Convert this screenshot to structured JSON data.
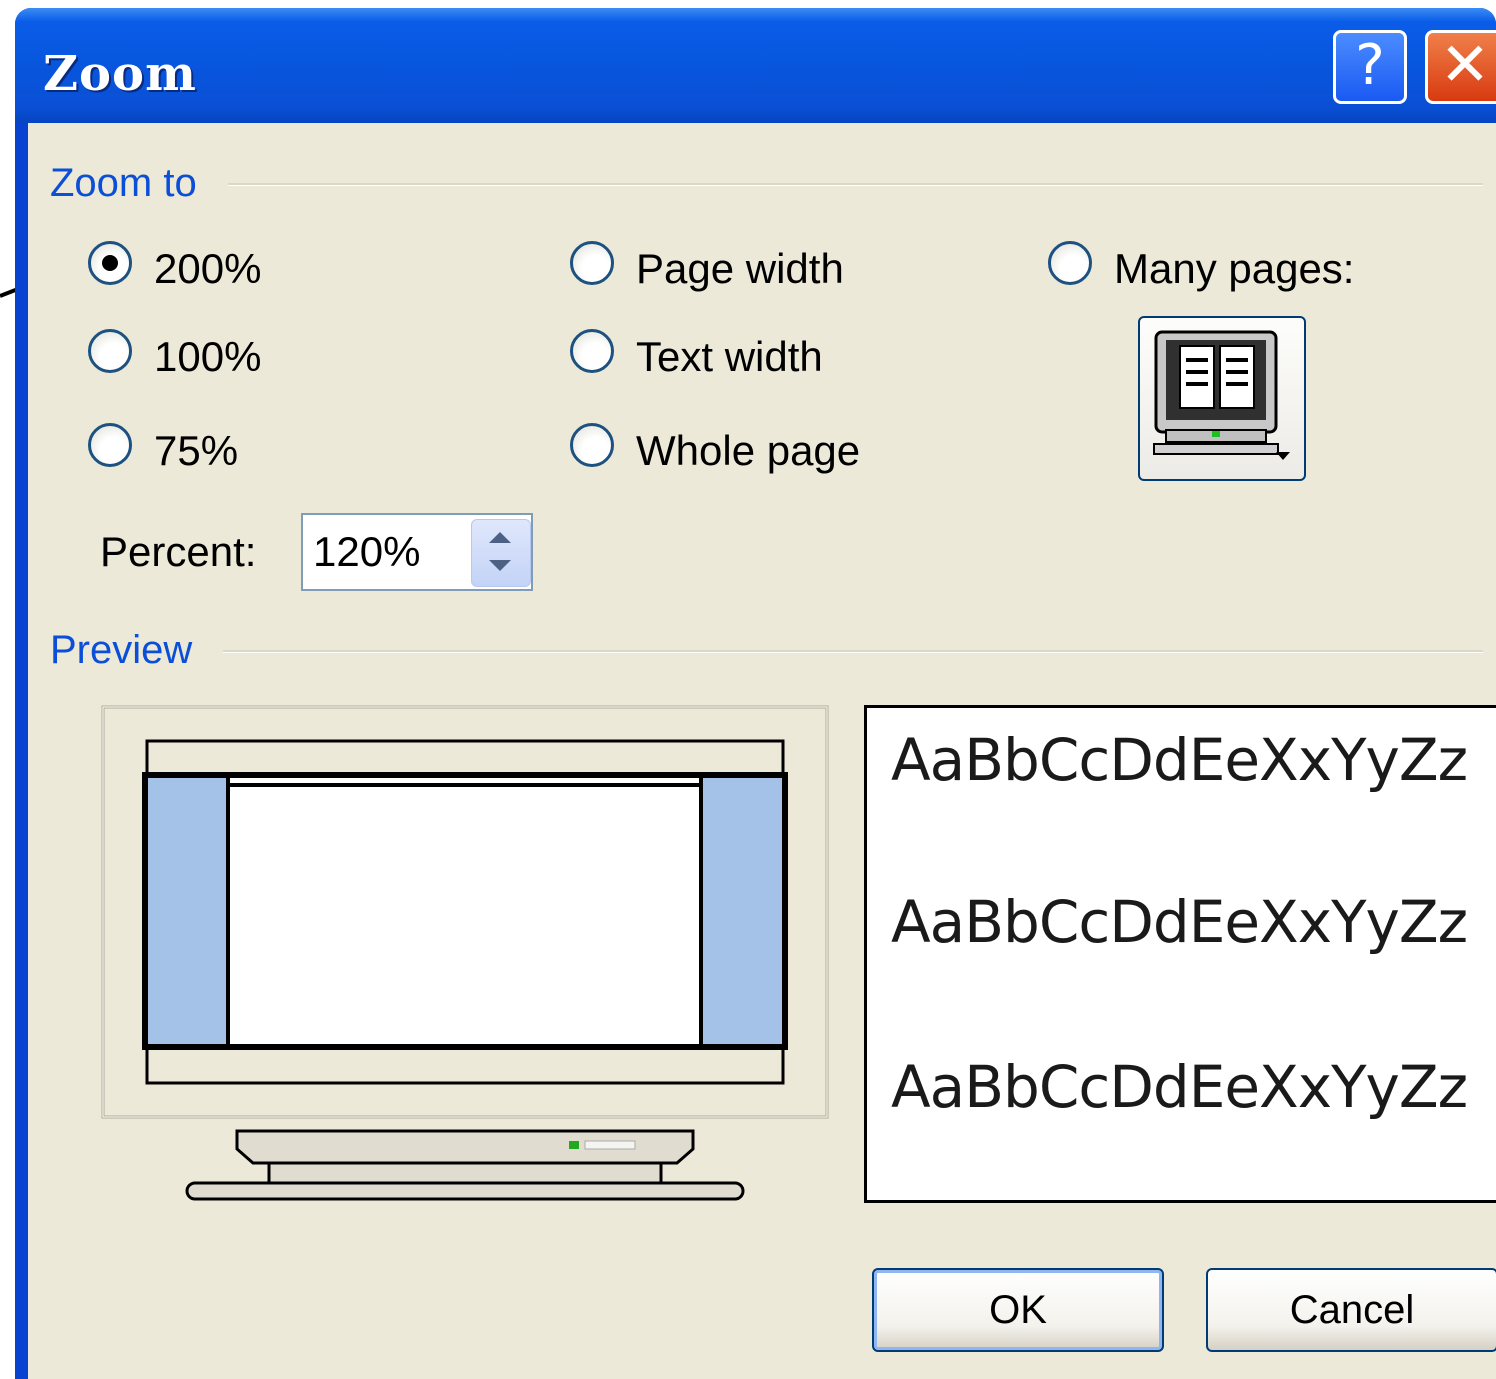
{
  "window": {
    "title": "Zoom",
    "help_button": "?",
    "close_button": "✕"
  },
  "zoom_to": {
    "label": "Zoom to",
    "options": [
      {
        "label": "200%",
        "selected": true
      },
      {
        "label": "100%",
        "selected": false
      },
      {
        "label": "75%",
        "selected": false
      },
      {
        "label": "Page width",
        "selected": false
      },
      {
        "label": "Text width",
        "selected": false
      },
      {
        "label": "Whole page",
        "selected": false
      },
      {
        "label": "Many pages:",
        "selected": false
      }
    ],
    "percent_label": "Percent:",
    "percent_value": "120%"
  },
  "preview": {
    "label": "Preview",
    "samples": [
      "AaBbCcDdEeXxYyZz",
      "AaBbCcDdEeXxYyZz",
      "AaBbCcDdEeXxYyZz"
    ]
  },
  "buttons": {
    "ok": "OK",
    "cancel": "Cancel"
  },
  "colors": {
    "titlebar": "#0a5ce8",
    "dialog_bg": "#ece9d8",
    "group_label": "#0b4fd9",
    "preview_margin": "#a4c2e8"
  }
}
